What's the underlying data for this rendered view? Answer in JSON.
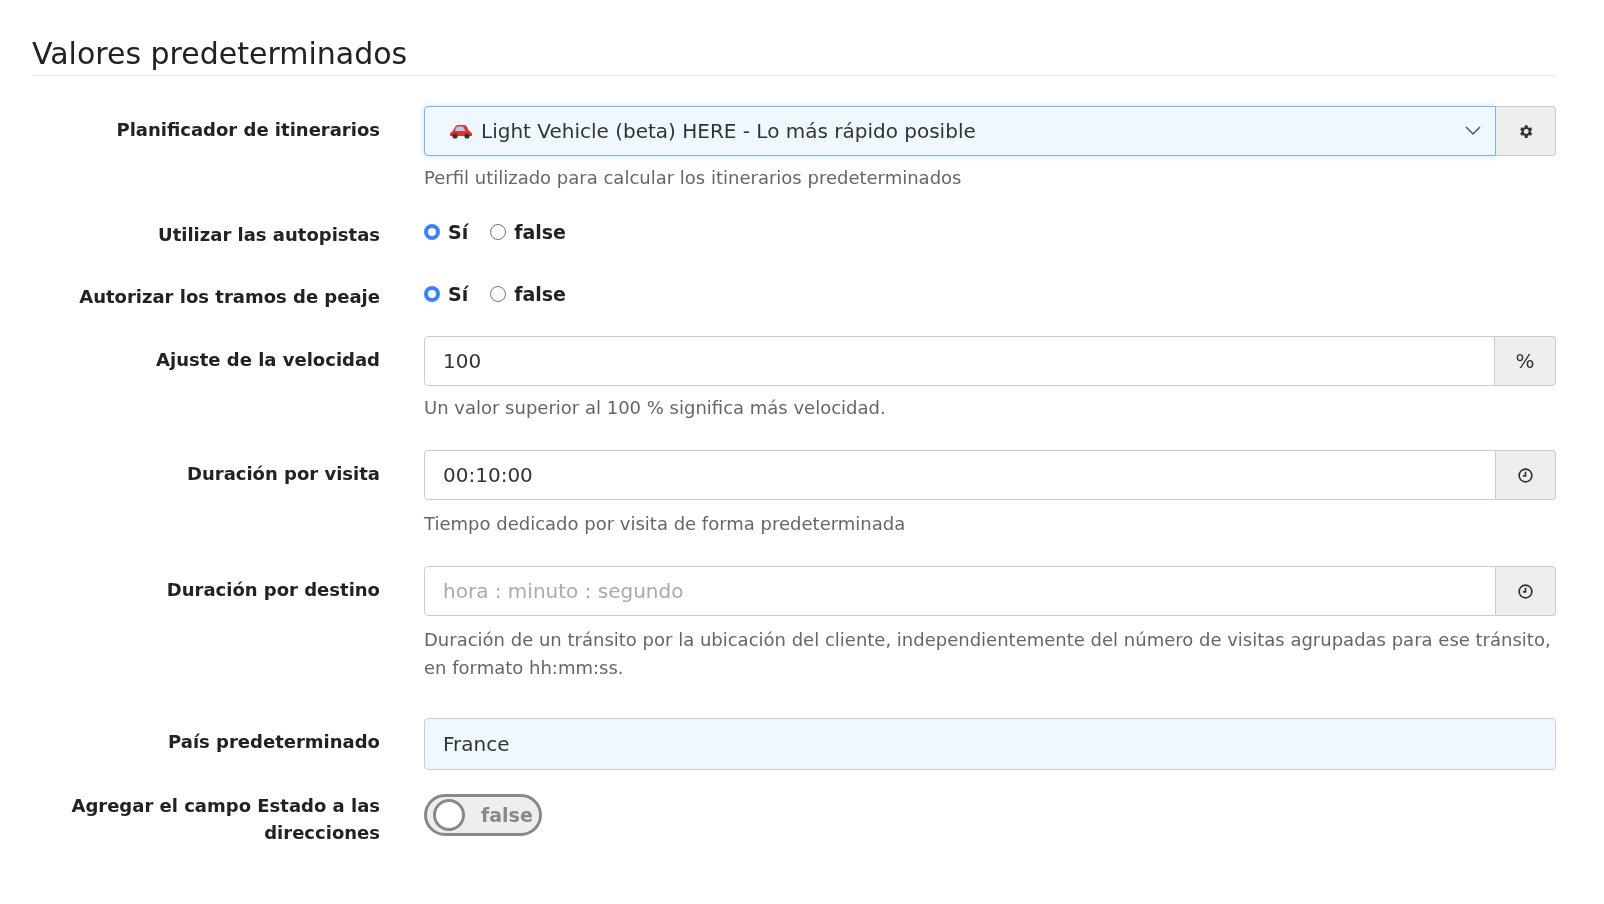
{
  "title": "Valores predeterminados",
  "fields": [
    {
      "kind": "select",
      "label": "Planificador de itinerarios",
      "value": "Light Vehicle (beta) HERE - Lo más rápido posible",
      "help": "Perfil utilizado para calcular los itinerarios predeterminados"
    },
    {
      "kind": "radio",
      "label": "Utilizar las autopistas",
      "options": [
        {
          "label": "Sí",
          "selected": true
        },
        {
          "label": "false",
          "selected": false
        }
      ]
    },
    {
      "kind": "radio",
      "label": "Autorizar los tramos de peaje",
      "options": [
        {
          "label": "Sí",
          "selected": true
        },
        {
          "label": "false",
          "selected": false
        }
      ]
    },
    {
      "kind": "addon",
      "label": "Ajuste de la velocidad",
      "value": "100",
      "addon": "%",
      "help": "Un valor superior al 100 % significa más velocidad."
    },
    {
      "kind": "time",
      "label": "Duración por visita",
      "value": "00:10:00",
      "help": "Tiempo dedicado por visita de forma predeterminada"
    },
    {
      "kind": "time",
      "label": "Duración por destino",
      "placeholder": "hora : minuto : segundo",
      "help": "Duración de un tránsito por la ubicación del cliente, independientemente del número de visitas agrupadas para ese tránsito, en formato hh:mm:ss."
    },
    {
      "kind": "text",
      "label": "País predeterminado",
      "value": "France"
    },
    {
      "kind": "toggle",
      "label": "Agregar el campo Estado a las direcciones",
      "on": false,
      "state_label": "false"
    }
  ]
}
